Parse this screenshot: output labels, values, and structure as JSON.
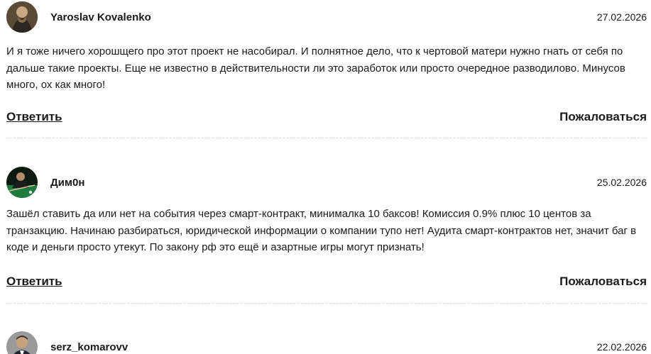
{
  "comments": [
    {
      "author": "Yaroslav Kovalenko",
      "date": "27.02.2026",
      "text": "И я тоже ничего хорошщего про этот проект не насобирал. И полнятное дело, что к чертовой матери нужно гнать от себя по дальше такие проекты. Еще не известно в действительности ли это заработок или просто очередное разводилово. Минусов много, ох как много!",
      "reply_label": "Ответить",
      "report_label": "Пожаловаться",
      "avatar_icon": "user-photo-icon"
    },
    {
      "author": "Дим0н",
      "date": "25.02.2026",
      "text": "Зашёл ставить да или нет на события через смарт-контракт, минималка 10 баксов! Комиссия 0.9% плюс 10 центов за транзакцию. Начинаю разбираться, юридической информации о компании тупо нет! Аудита смарт-контрактов нет, значит баг в коде и деньги просто утекут. По закону рф это ещё и азартные игры могут признать!",
      "reply_label": "Ответить",
      "report_label": "Пожаловаться",
      "avatar_icon": "billiards-photo-icon"
    },
    {
      "author": "serz_komarovv",
      "date": "22.02.2026",
      "avatar_icon": "man-in-suit-photo-icon"
    }
  ]
}
